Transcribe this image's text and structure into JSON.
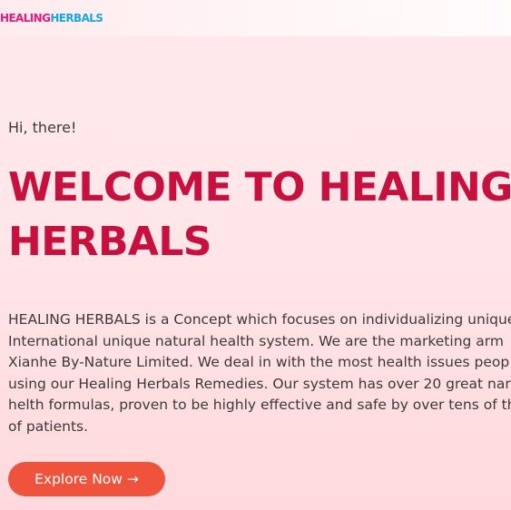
{
  "header": {
    "logo": {
      "part1": "HEALING",
      "part2": "HERBALS",
      "color1": "#e5197e",
      "color2": "#1aa6df"
    }
  },
  "hero": {
    "greeting": "Hi, there!",
    "headline_lines": [
      "WELCOME TO HEALING",
      "HERBALS"
    ],
    "headline_color": "#c8103e",
    "description_lines": [
      "HEALING HERBALS is a Concept which focuses on individualizing unique",
      "International unique natural health system. We are the marketing arm",
      "Xianhe By-Nature Limited. We deal in with the most health issues peop",
      "using our Healing Herbals Remedies. Our system has over 20 great nar",
      "helth formulas, proven to be highly effective and safe by over tens of th",
      "of patients."
    ],
    "cta_label": "Explore Now →",
    "cta_color": "#f0533b"
  }
}
